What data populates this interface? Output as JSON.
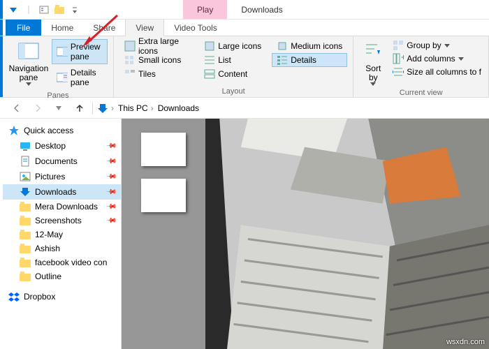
{
  "title_bar": {
    "play_tab": "Play",
    "title": "Downloads"
  },
  "tabs": {
    "file": "File",
    "home": "Home",
    "share": "Share",
    "view": "View",
    "video_tools": "Video Tools"
  },
  "ribbon": {
    "panes": {
      "navigation": "Navigation pane",
      "preview": "Preview pane",
      "details": "Details pane",
      "label": "Panes"
    },
    "layout": {
      "xl": "Extra large icons",
      "lg": "Large icons",
      "md": "Medium icons",
      "sm": "Small icons",
      "list": "List",
      "details": "Details",
      "tiles": "Tiles",
      "content": "Content",
      "label": "Layout"
    },
    "current_view": {
      "sort": "Sort by",
      "group": "Group by",
      "add_cols": "Add columns",
      "size_cols": "Size all columns to f",
      "label": "Current view"
    }
  },
  "breadcrumb": {
    "this_pc": "This PC",
    "downloads": "Downloads"
  },
  "nav": {
    "quick_access": "Quick access",
    "items": [
      {
        "label": "Desktop",
        "pin": true
      },
      {
        "label": "Documents",
        "pin": true
      },
      {
        "label": "Pictures",
        "pin": true
      },
      {
        "label": "Downloads",
        "pin": true,
        "sel": true
      },
      {
        "label": "Mera Downloads",
        "pin": true
      },
      {
        "label": "Screenshots",
        "pin": true
      },
      {
        "label": "12-May",
        "pin": false
      },
      {
        "label": "Ashish",
        "pin": false
      },
      {
        "label": "facebook video con",
        "pin": false
      },
      {
        "label": "Outline",
        "pin": false
      }
    ],
    "dropbox": "Dropbox"
  },
  "watermark": "wsxdn.com"
}
